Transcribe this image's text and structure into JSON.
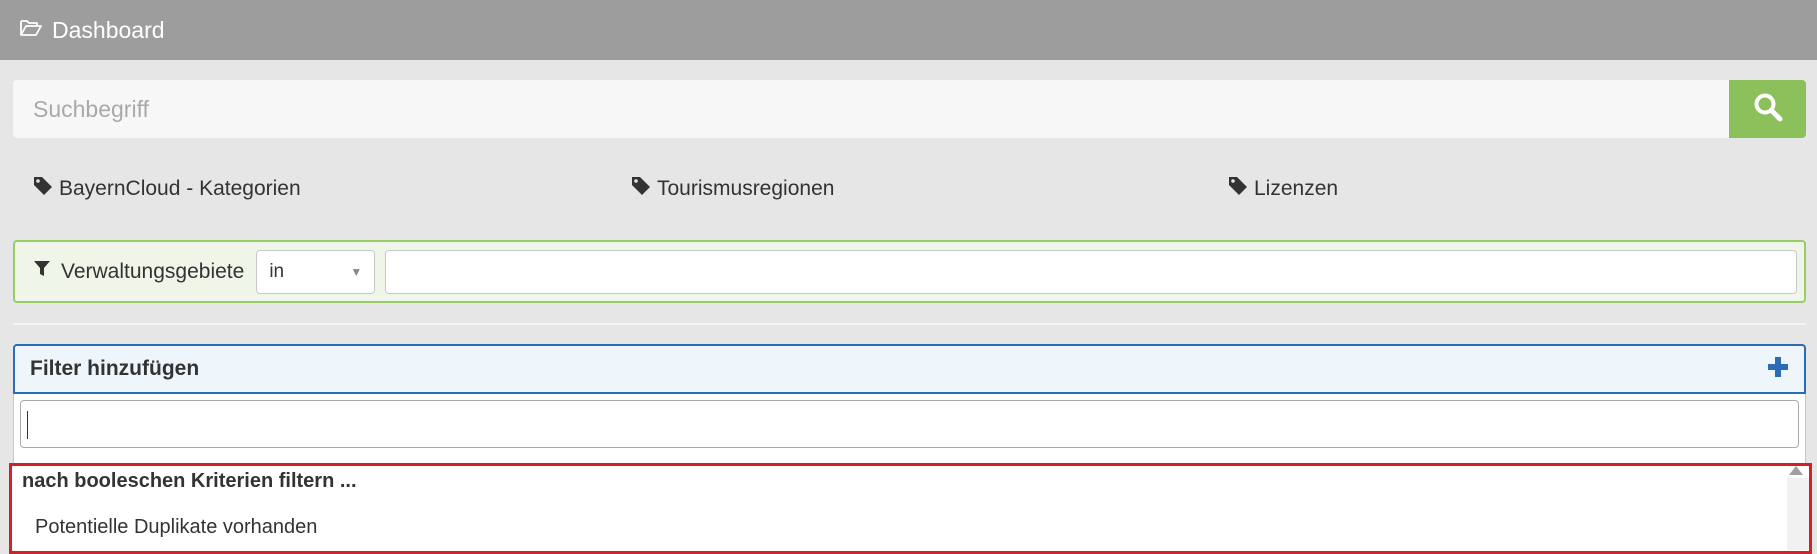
{
  "header": {
    "title": "Dashboard",
    "icon": "folder-open-icon"
  },
  "search": {
    "placeholder": "Suchbegriff",
    "value": "",
    "button_icon": "search-icon",
    "button_color": "#8bc05a"
  },
  "tags": [
    {
      "label": "BayernCloud - Kategorien",
      "icon": "tag-icon"
    },
    {
      "label": "Tourismusregionen",
      "icon": "tag-icon"
    },
    {
      "label": "Lizenzen",
      "icon": "tag-icon"
    }
  ],
  "filter": {
    "icon": "filter-icon",
    "label": "Verwaltungsgebiete",
    "operator": "in",
    "value": "",
    "border_color": "#99cc66"
  },
  "add_filter": {
    "label": "Filter hinzufügen",
    "icon": "plus-icon",
    "accent_color": "#2a6db6"
  },
  "dropdown": {
    "search_value": "",
    "group_title": "nach booleschen Kriterien filtern ...",
    "options": [
      "Potentielle Duplikate vorhanden"
    ],
    "highlight_color": "#d42027"
  }
}
